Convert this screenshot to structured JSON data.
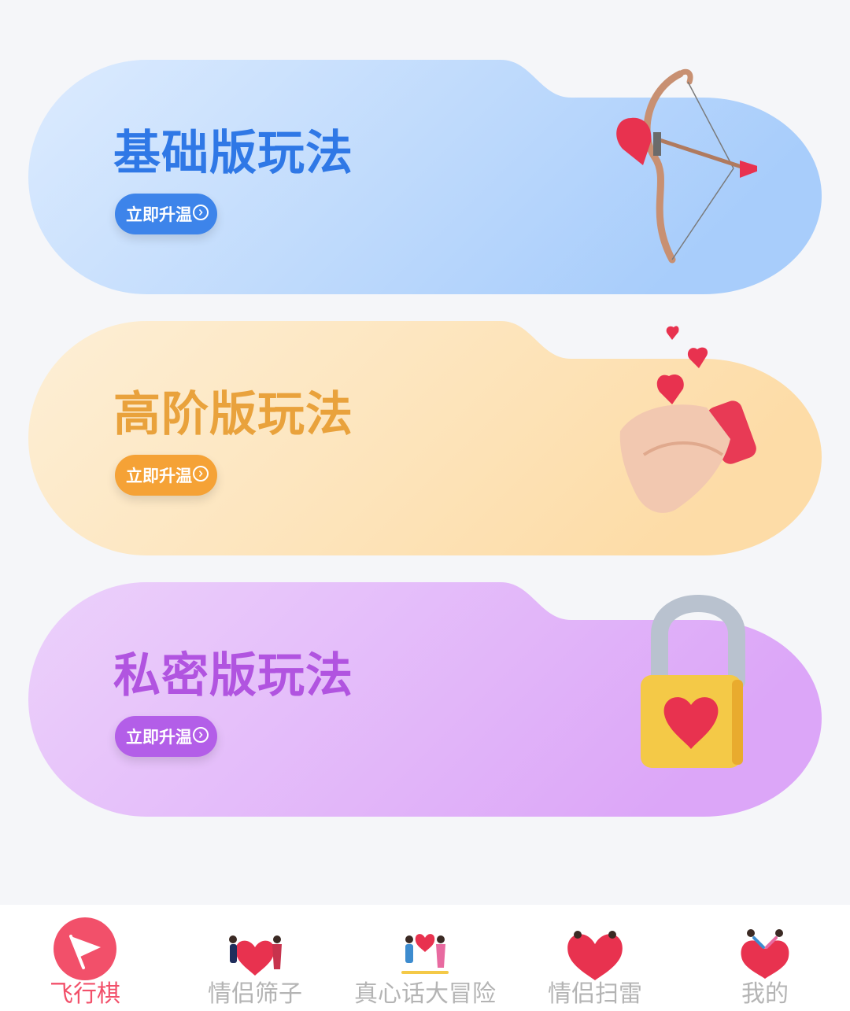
{
  "cards": [
    {
      "title": "基础版玩法",
      "button_label": "立即升温",
      "title_color": "#2f78e6",
      "button_color": "#3d84ea",
      "art": "cupid-bow-icon"
    },
    {
      "title": "高阶版玩法",
      "button_label": "立即升温",
      "title_color": "#e9a23c",
      "button_color": "#f5a236",
      "art": "handshake-icon"
    },
    {
      "title": "私密版玩法",
      "button_label": "立即升温",
      "title_color": "#b154e0",
      "button_color": "#b35ee8",
      "art": "heart-padlock-icon"
    }
  ],
  "tabbar": {
    "active_color": "#f2506a",
    "items": [
      {
        "label": "飞行棋",
        "icon": "flag-icon",
        "active": true
      },
      {
        "label": "情侣筛子",
        "icon": "couple-heart-icon",
        "active": false
      },
      {
        "label": "真心话大冒险",
        "icon": "couple-exchange-heart-icon",
        "active": false
      },
      {
        "label": "情侣扫雷",
        "icon": "couple-big-heart-icon",
        "active": false
      },
      {
        "label": "我的",
        "icon": "couple-hug-heart-icon",
        "active": false
      }
    ]
  }
}
